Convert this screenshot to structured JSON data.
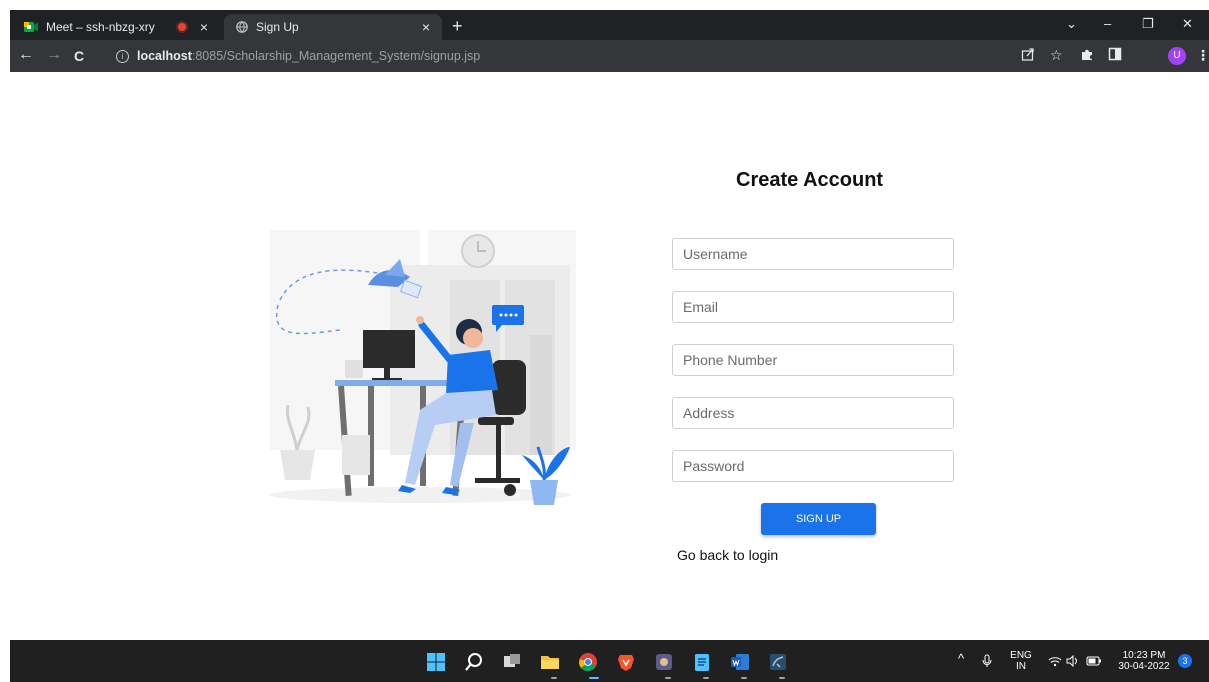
{
  "browser": {
    "tabs": [
      {
        "title": "Meet – ssh-nbzg-xry",
        "close": "×"
      },
      {
        "title": "Sign Up",
        "close": "×"
      }
    ],
    "new_tab": "+",
    "window_controls": {
      "chevron": "⌄",
      "minimize": "–",
      "restore": "❐",
      "close": "✕"
    },
    "nav": {
      "back": "←",
      "forward": "→",
      "reload": "C"
    },
    "url": {
      "host": "localhost",
      "rest": ":8085/Scholarship_Management_System/signup.jsp"
    },
    "profile_initial": "U",
    "ext_icons": [
      "share-icon",
      "star-icon",
      "puzzle-icon",
      "sidepanel-icon",
      "menu-icon"
    ]
  },
  "page": {
    "title": "Create Account",
    "fields": [
      {
        "placeholder": "Username"
      },
      {
        "placeholder": "Email"
      },
      {
        "placeholder": "Phone Number"
      },
      {
        "placeholder": "Address"
      },
      {
        "placeholder": "Password"
      }
    ],
    "signup_label": "SIGN UP",
    "back_link": "Go back to login",
    "accent": "#1a73e8"
  },
  "taskbar": {
    "apps": [
      "start-icon",
      "search-icon",
      "taskview-icon",
      "file-explorer-icon",
      "chrome-icon",
      "brave-icon",
      "app-icon",
      "notepad-icon",
      "word-icon",
      "mysql-workbench-icon"
    ],
    "tray": {
      "lang_top": "ENG",
      "lang_bottom": "IN",
      "time": "10:23 PM",
      "date": "30-04-2022",
      "notifications": "3"
    }
  }
}
